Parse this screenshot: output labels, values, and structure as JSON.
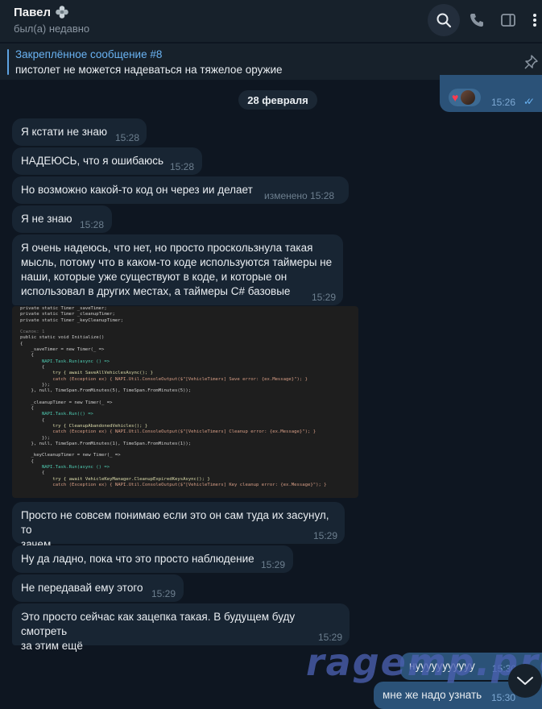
{
  "header": {
    "name": "Павел",
    "status": "был(а) недавно"
  },
  "pinned": {
    "title": "Закреплённое сообщение #8",
    "text": "пистолет не можется надеваться на тяжелое оружие"
  },
  "top_outgoing": {
    "time": "15:26"
  },
  "date_separator": "28 февраля",
  "messages": [
    {
      "text": "Я кстати не знаю",
      "time": "15:28"
    },
    {
      "text": "НАДЕЮСЬ, что я ошибаюсь",
      "time": "15:28"
    },
    {
      "text": "Но возможно какой-то код он через ии делает",
      "time": "изменено 15:28"
    },
    {
      "text": "Я не знаю",
      "time": "15:28"
    },
    {
      "line1": "Я очень надеюсь, что нет, но просто проскользнула такая",
      "line2": "мысль, потому что в каком-то коде используются таймеры не",
      "line3": "наши, которые уже существуют в коде, и которые он",
      "line4": "использовал в других местах, а таймеры C# базовые",
      "time": "15:29"
    },
    {
      "line1": "Просто не совсем понимаю если это он сам туда их засунул, то",
      "line2": "зачем",
      "time": "15:29"
    },
    {
      "text": "Ну да ладно, пока что это просто наблюдение",
      "time": "15:29"
    },
    {
      "text": "Не передавай ему этого",
      "time": "15:29"
    },
    {
      "line1": "Это просто сейчас как зацепка такая. В будущем буду смотреть",
      "line2": "за этим ещё",
      "time": "15:29"
    }
  ],
  "outgoing": [
    {
      "text": "нууууууууууу",
      "time": "15:30"
    },
    {
      "text": "мне же надо узнать",
      "time": "15:30"
    }
  ],
  "watermark": "ragemp.pro",
  "code": {
    "l1": "private static Timer _saveTimer;",
    "l2": "private static Timer _cleanupTimer;",
    "l3": "private static Timer _keyCleanupTimer;",
    "l4": "Ссылок: 1",
    "l5": "public static void Initialize()",
    "l6": "{",
    "l7": "    _saveTimer = new Timer(_ =>",
    "l8": "    {",
    "l9": "        NAPI.Task.Run(async () =>",
    "l10": "        {",
    "l11": "            try { await SaveAllVehiclesAsync(); }",
    "l12": "            catch (Exception ex) { NAPI.Util.ConsoleOutput($\"[VehicleTimers] Save error: {ex.Message}\"); }",
    "l13": "        });",
    "l14": "    }, null, TimeSpan.FromMinutes(5), TimeSpan.FromMinutes(5));",
    "l15": "",
    "l16": "    _cleanupTimer = new Timer(_ =>",
    "l17": "    {",
    "l18": "        NAPI.Task.Run(() =>",
    "l19": "        {",
    "l20": "            try { CleanupAbandonedVehicles(); }",
    "l21": "            catch (Exception ex) { NAPI.Util.ConsoleOutput($\"[VehicleTimers] Cleanup error: {ex.Message}\"); }",
    "l22": "        });",
    "l23": "    }, null, TimeSpan.FromMinutes(1), TimeSpan.FromMinutes(1));",
    "l24": "",
    "l25": "    _keyCleanupTimer = new Timer(_ =>",
    "l26": "    {",
    "l27": "        NAPI.Task.Run(async () =>",
    "l28": "        {",
    "l29": "            try { await VehicleKeyManager.CleanupExpiredKeysAsync(); }",
    "l30": "            catch (Exception ex) { NAPI.Util.ConsoleOutput($\"[VehicleTimers] Key cleanup error: {ex.Message}\"); }"
  },
  "colors": {
    "background": "#0e1621",
    "header": "#17212b",
    "incoming_bubble": "#182533",
    "outgoing_bubble": "#2b5278",
    "accent": "#6ab3f3"
  }
}
